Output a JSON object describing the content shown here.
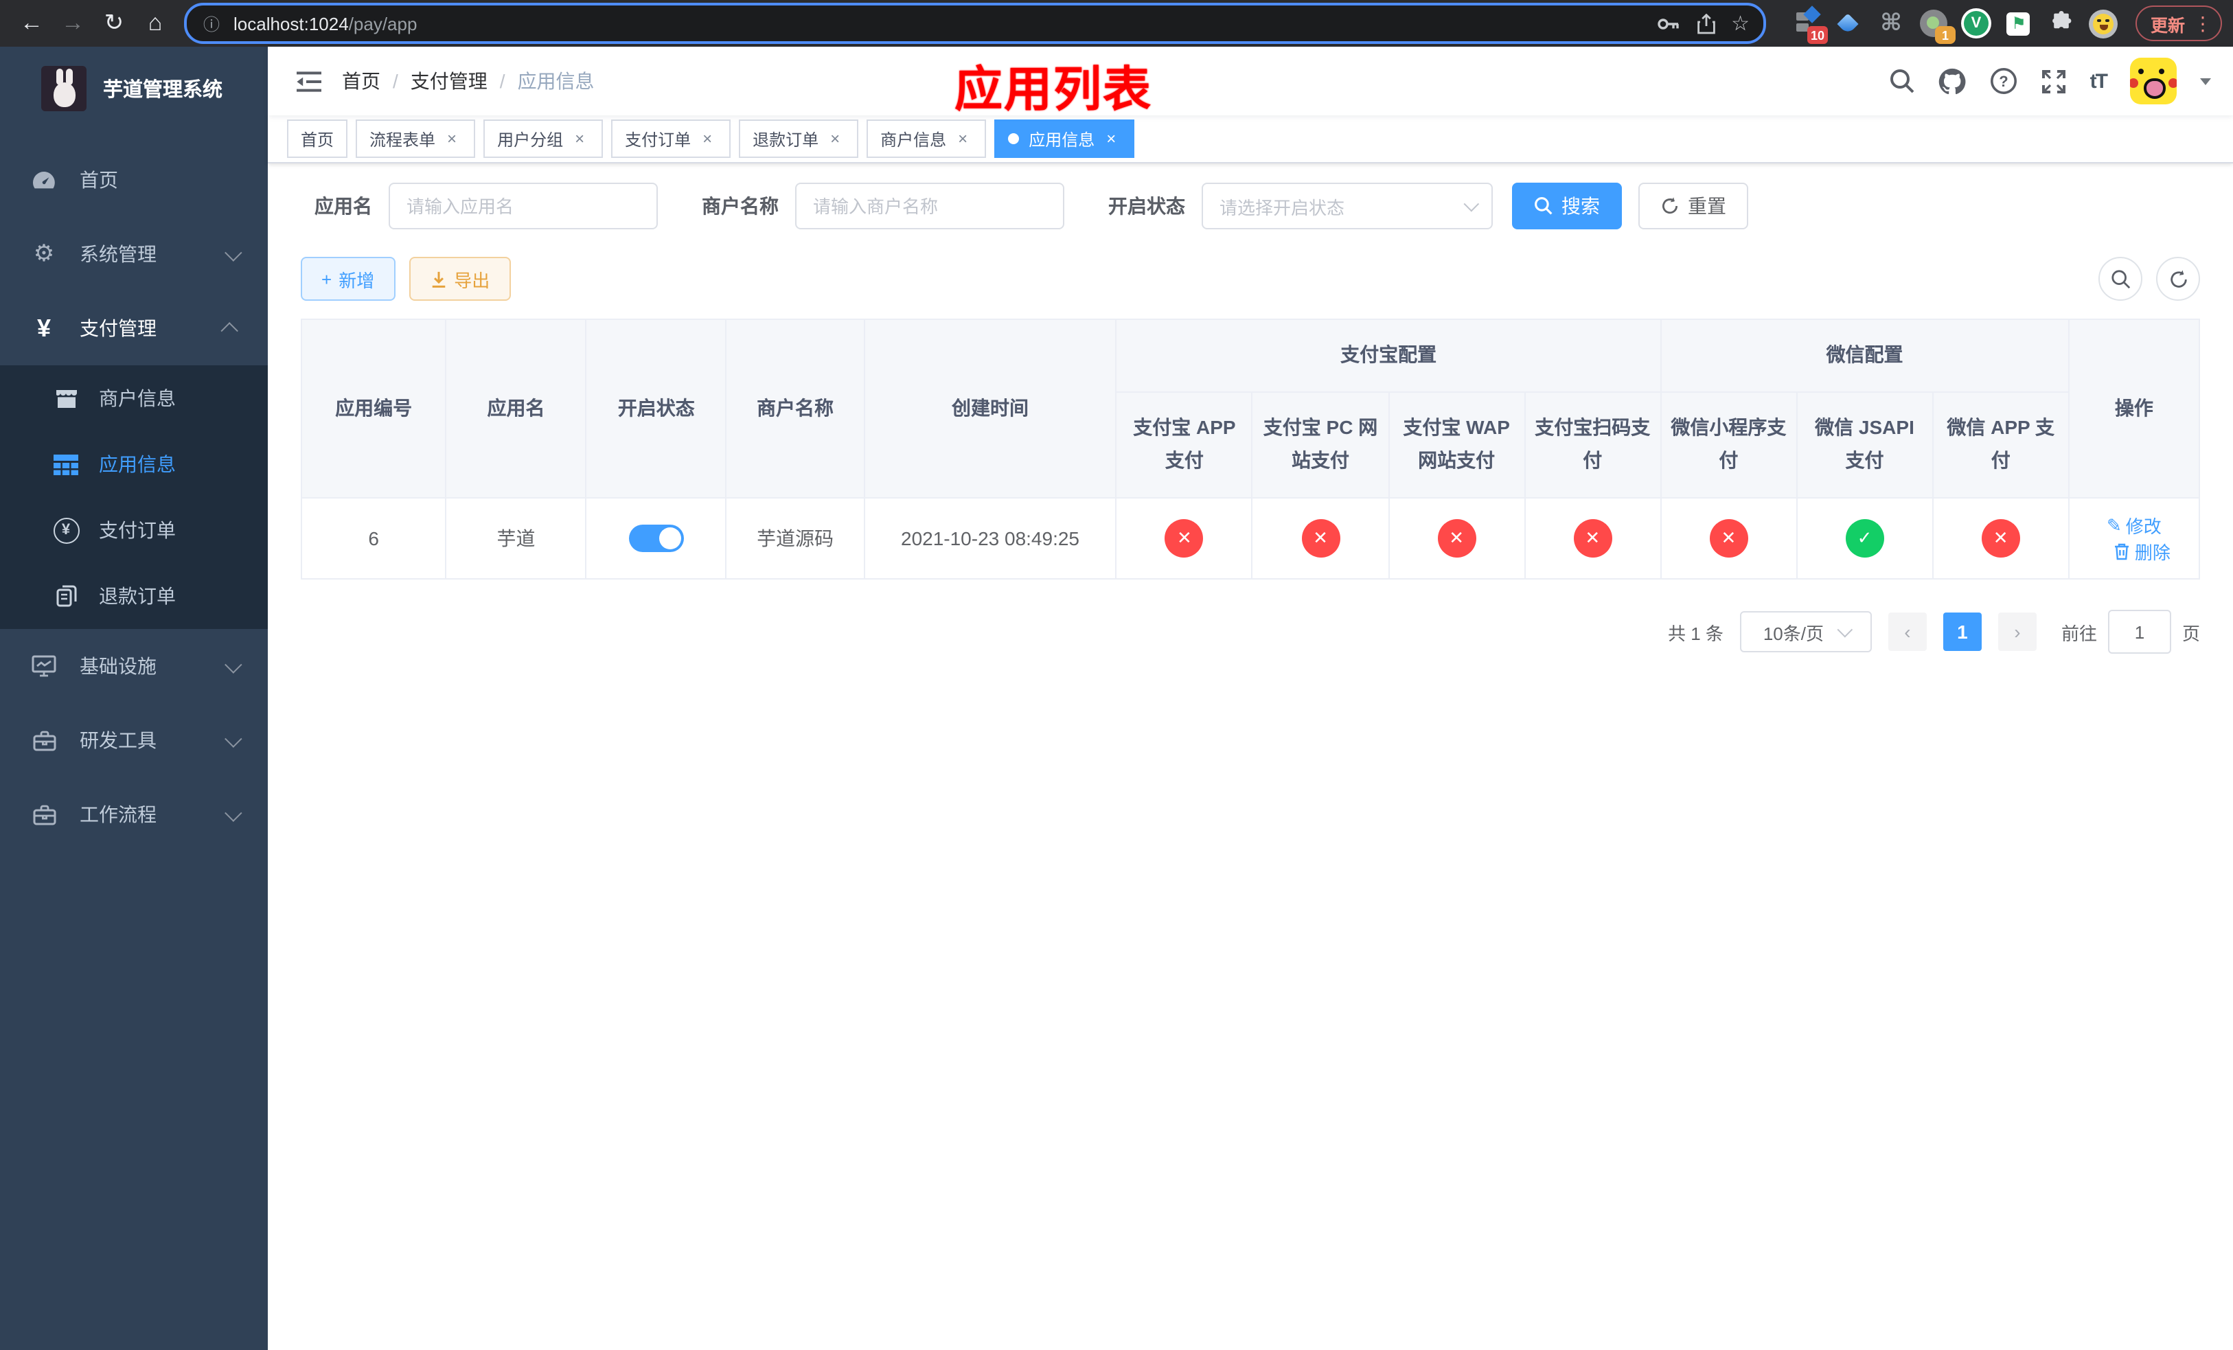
{
  "browser": {
    "url_host": "localhost:1024",
    "url_path": "/pay/app",
    "update_label": "更新",
    "ext_badge_panel": "10",
    "ext_badge_circle": "1"
  },
  "icons": {
    "back": "←",
    "forward": "→",
    "reload": "↻",
    "home": "⌂",
    "info": "ⓘ",
    "star": "☆",
    "kebab": "⋮",
    "command": "⌘",
    "vue_letter": "V",
    "flag": "⚑",
    "question": "?",
    "font_size": "tT",
    "plus": "+",
    "close": "×",
    "check": "✓",
    "cross": "✕",
    "pencil": "✎",
    "prev": "‹",
    "next": "›",
    "yen": "¥"
  },
  "sidebar": {
    "title": "芋道管理系统",
    "top_items": [
      {
        "label": "首页"
      },
      {
        "label": "系统管理"
      },
      {
        "label": "支付管理"
      }
    ],
    "submenu": [
      {
        "label": "商户信息"
      },
      {
        "label": "应用信息"
      },
      {
        "label": "支付订单"
      },
      {
        "label": "退款订单"
      }
    ],
    "bottom_items": [
      {
        "label": "基础设施"
      },
      {
        "label": "研发工具"
      },
      {
        "label": "工作流程"
      }
    ]
  },
  "header": {
    "breadcrumb": [
      "首页",
      "支付管理",
      "应用信息"
    ],
    "separator": "/",
    "annotation": "应用列表"
  },
  "tabs": [
    {
      "label": "首页"
    },
    {
      "label": "流程表单"
    },
    {
      "label": "用户分组"
    },
    {
      "label": "支付订单"
    },
    {
      "label": "退款订单"
    },
    {
      "label": "商户信息"
    },
    {
      "label": "应用信息"
    }
  ],
  "filters": {
    "app_name_label": "应用名",
    "app_name_placeholder": "请输入应用名",
    "merchant_label": "商户名称",
    "merchant_placeholder": "请输入商户名称",
    "status_label": "开启状态",
    "status_placeholder": "请选择开启状态",
    "search_label": "搜索",
    "reset_label": "重置"
  },
  "toolbar": {
    "add_label": "新增",
    "export_label": "导出"
  },
  "table": {
    "columns": {
      "app_id": "应用编号",
      "app_name": "应用名",
      "status": "开启状态",
      "merchant": "商户名称",
      "created": "创建时间",
      "alipay_group": "支付宝配置",
      "wechat_group": "微信配置",
      "pay_cols": [
        "支付宝 APP 支付",
        "支付宝 PC 网站支付",
        "支付宝 WAP 网站支付",
        "支付宝扫码支付",
        "微信小程序支付",
        "微信 JSAPI 支付",
        "微信 APP 支付"
      ],
      "actions": "操作"
    },
    "row": {
      "id": "6",
      "name": "芋道",
      "enabled": true,
      "merchant": "芋道源码",
      "created": "2021-10-23 08:49:25",
      "statuses": [
        false,
        false,
        false,
        false,
        false,
        true,
        false
      ],
      "edit_label": "修改",
      "delete_label": "删除"
    }
  },
  "pagination": {
    "total": "共 1 条",
    "per_page": "10条/页",
    "page": "1",
    "goto_prefix": "前往",
    "goto_value": "1",
    "goto_suffix": "页"
  },
  "colors": {
    "accent": "#409eff",
    "success": "#13ce66",
    "danger": "#ff4949",
    "sidebar_bg": "#304156",
    "submenu_bg": "#1f2d3d",
    "annotation": "#fe0000"
  }
}
